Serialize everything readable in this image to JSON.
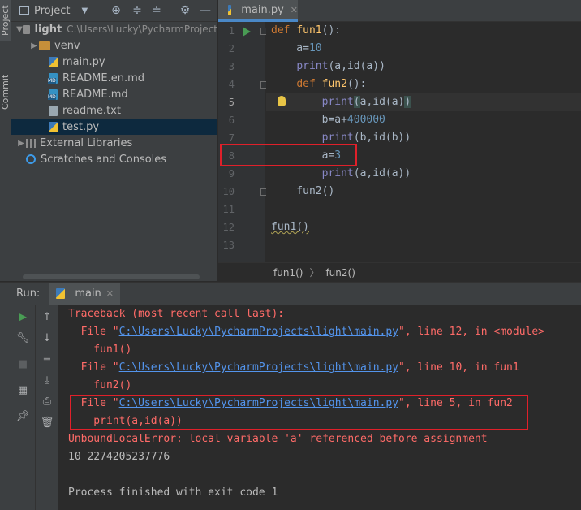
{
  "side_tabs": {
    "project": "Project",
    "commit": "Commit"
  },
  "project_panel": {
    "title": "Project",
    "tree": [
      {
        "label": "light",
        "path": "C:\\Users\\Lucky\\PycharmProject",
        "kind": "root"
      },
      {
        "label": "venv",
        "kind": "folder"
      },
      {
        "label": "main.py",
        "kind": "py"
      },
      {
        "label": "README.en.md",
        "kind": "md"
      },
      {
        "label": "README.md",
        "kind": "md"
      },
      {
        "label": "readme.txt",
        "kind": "txt"
      },
      {
        "label": "test.py",
        "kind": "py",
        "selected": true
      },
      {
        "label": "External Libraries",
        "kind": "lib"
      },
      {
        "label": "Scratches and Consoles",
        "kind": "scratch"
      }
    ]
  },
  "editor": {
    "tab_label": "main.py",
    "line_numbers": [
      "1",
      "2",
      "3",
      "4",
      "5",
      "6",
      "7",
      "8",
      "9",
      "10",
      "11",
      "12",
      "13"
    ],
    "breadcrumb": [
      "fun1()",
      "fun2()"
    ],
    "code": {
      "l1_kw": "def ",
      "l1_fn": "fun1",
      "l1_rest": "():",
      "l2_a": "    a=",
      "l2_num": "10",
      "l3_pre": "    ",
      "l3_print": "print",
      "l3_rest": "(a,id(a))",
      "l4_pre": "    ",
      "l4_kw": "def ",
      "l4_fn": "fun2",
      "l4_rest": "():",
      "l5_pre": "        ",
      "l5_print": "print",
      "l5_open": "(",
      "l5_mid": "a,id(a)",
      "l5_close": ")",
      "l6_a": "        b=a+",
      "l6_num": "400000",
      "l7_pre": "        ",
      "l7_print": "print",
      "l7_rest": "(b,id(b))",
      "l8_a": "        a=",
      "l8_num": "3",
      "l9_pre": "        ",
      "l9_print": "print",
      "l9_rest": "(a,id(a))",
      "l10": "    fun2()",
      "l12": "fun1()"
    }
  },
  "run_panel": {
    "title": "Run:",
    "tab_label": "main",
    "console": {
      "l1": "Traceback (most recent call last):",
      "l2_pre": "  File \"",
      "l2_link": "C:\\Users\\Lucky\\PycharmProjects\\light\\main.py",
      "l2_post": "\", line 12, in <module>",
      "l3": "    fun1()",
      "l4_pre": "  File \"",
      "l4_link": "C:\\Users\\Lucky\\PycharmProjects\\light\\main.py",
      "l4_post": "\", line 10, in fun1",
      "l5": "    fun2()",
      "l6_pre": "  File \"",
      "l6_link": "C:\\Users\\Lucky\\PycharmProjects\\light\\main.py",
      "l6_post": "\", line 5, in fun2",
      "l7": "    print(a,id(a))",
      "l8": "UnboundLocalError: local variable 'a' referenced before assignment",
      "l9": "10 2274205237776",
      "l11": "Process finished with exit code 1"
    }
  },
  "colors": {
    "error_text": "#ff6b68",
    "link": "#5394ec",
    "highlight_box": "#e0202a",
    "keyword": "#cc7832",
    "function": "#ffc66d",
    "number": "#6897bb"
  }
}
